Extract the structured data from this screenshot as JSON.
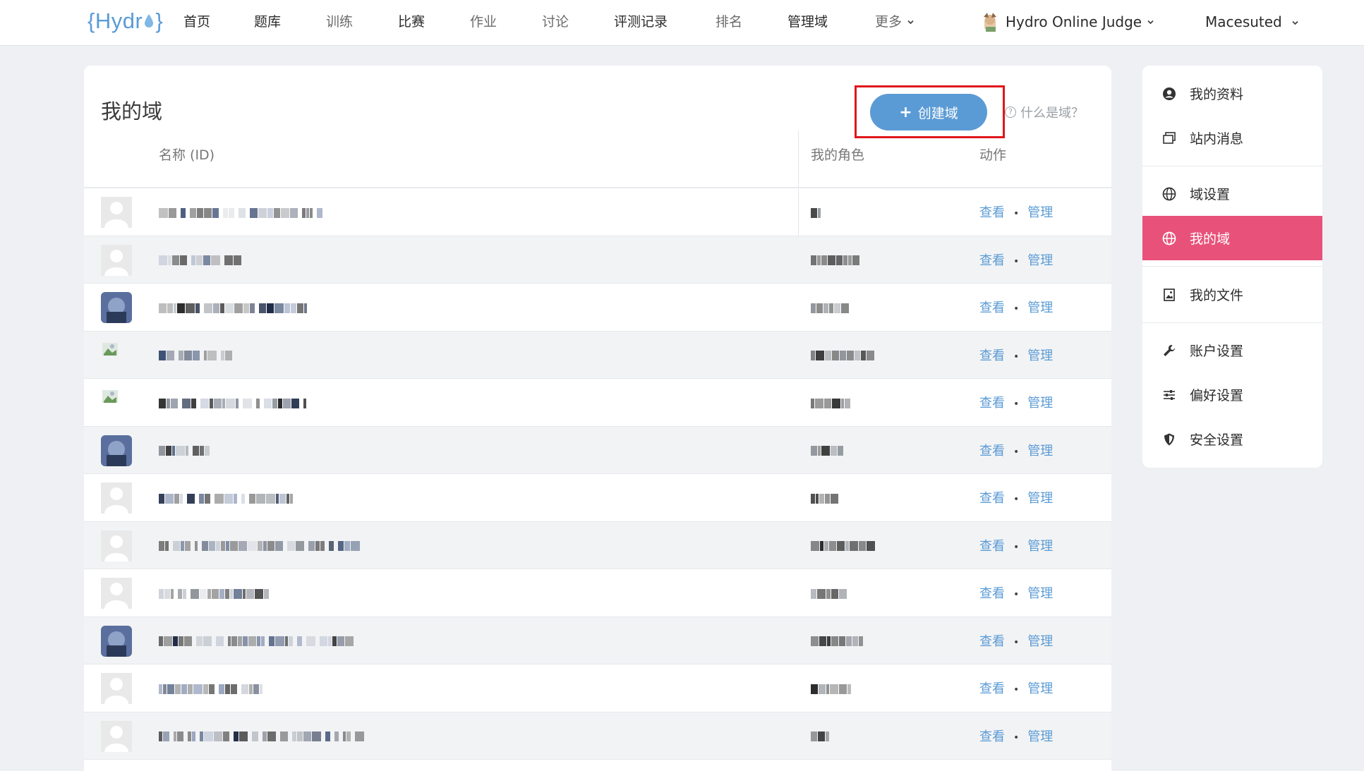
{
  "header": {
    "logo_text": "{Hydro}",
    "nav": [
      {
        "label": "首页"
      },
      {
        "label": "题库"
      },
      {
        "label": "训练"
      },
      {
        "label": "比赛"
      },
      {
        "label": "作业"
      },
      {
        "label": "讨论"
      },
      {
        "label": "评测记录"
      },
      {
        "label": "排名"
      },
      {
        "label": "管理域"
      },
      {
        "label": "更多"
      }
    ],
    "site_name": "Hydro Online Judge",
    "username": "Macesuted"
  },
  "main": {
    "title": "我的域",
    "create_button": "创建域",
    "help_link": "什么是域？",
    "columns": {
      "name": "名称 (ID)",
      "role": "我的角色",
      "actions": "动作"
    },
    "action_view": "查看",
    "action_manage": "管理",
    "row_count": 12
  },
  "sidebar": {
    "items": [
      {
        "label": "我的资料",
        "icon": "user-circle-icon"
      },
      {
        "label": "站内消息",
        "icon": "message-icon"
      },
      {
        "label": "域设置",
        "icon": "globe-icon"
      },
      {
        "label": "我的域",
        "icon": "globe-icon",
        "active": true
      },
      {
        "label": "我的文件",
        "icon": "image-file-icon"
      },
      {
        "label": "账户设置",
        "icon": "wrench-icon"
      },
      {
        "label": "偏好设置",
        "icon": "sliders-icon"
      },
      {
        "label": "安全设置",
        "icon": "shield-icon"
      }
    ]
  },
  "colors": {
    "accent": "#5b9bd5",
    "active": "#e8527a",
    "highlight": "#e0161b"
  }
}
